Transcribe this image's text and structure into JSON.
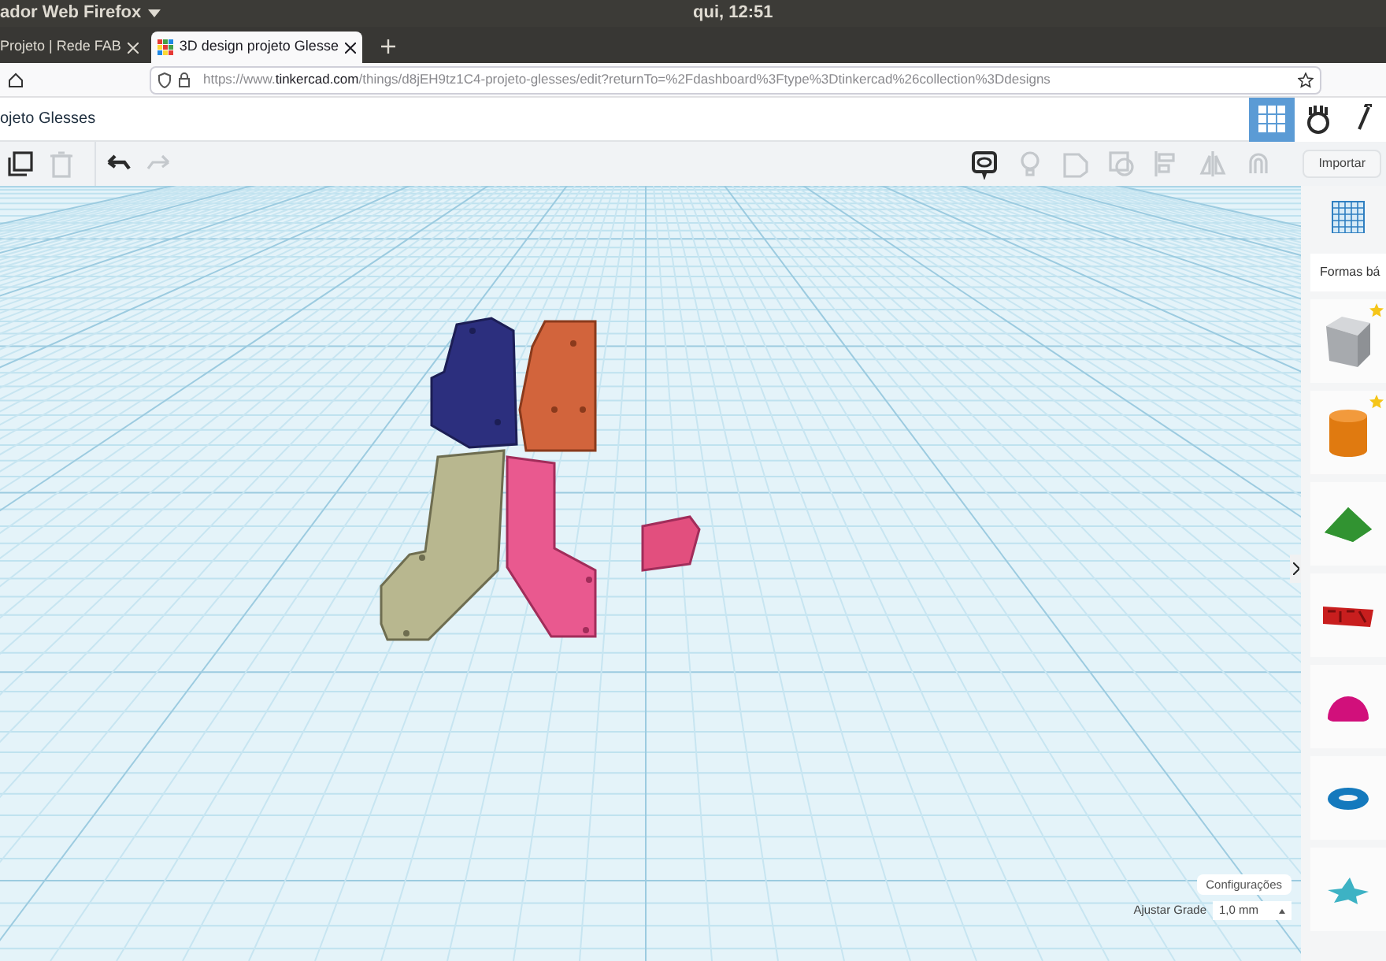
{
  "system_bar": {
    "app_menu": "ador Web Firefox",
    "clock": "qui, 12:51"
  },
  "browser": {
    "tabs": [
      {
        "label": "Projeto | Rede FAB",
        "selected": false
      },
      {
        "label": "3D design projeto Glesse",
        "selected": true
      }
    ],
    "url": {
      "prefix": "https://www.",
      "host": "tinkercad.com",
      "path": "/things/d8jEH9tz1C4-projeto-glesses/edit?returnTo=%2Fdashboard%3Ftype%3Dtinkercad%26collection%3Ddesigns"
    }
  },
  "header": {
    "title": "ojeto Glesses",
    "views": [
      {
        "kind": "grid",
        "selected": true
      },
      {
        "kind": "blocks",
        "selected": false
      },
      {
        "kind": "bricks",
        "selected": false
      }
    ]
  },
  "toolbar": {
    "left": [
      {
        "kind": "copy",
        "disabled": false
      },
      {
        "kind": "delete",
        "disabled": true
      },
      {
        "kind": "undo",
        "disabled": false
      },
      {
        "kind": "redo",
        "disabled": true
      }
    ],
    "right": [
      {
        "kind": "notes",
        "disabled": false
      },
      {
        "kind": "light",
        "disabled": true
      },
      {
        "kind": "solid",
        "disabled": true
      },
      {
        "kind": "hole",
        "disabled": true
      },
      {
        "kind": "align",
        "disabled": true
      },
      {
        "kind": "mirror",
        "disabled": true
      },
      {
        "kind": "magnet",
        "disabled": true
      }
    ],
    "import_button": "Importar"
  },
  "panel": {
    "category": "Formas bá",
    "shapes": [
      {
        "kind": "box",
        "starred": true
      },
      {
        "kind": "cylinder",
        "starred": true
      },
      {
        "kind": "roof",
        "starred": false
      },
      {
        "kind": "text",
        "starred": false
      },
      {
        "kind": "half-sphere",
        "starred": false
      },
      {
        "kind": "torus",
        "starred": false
      },
      {
        "kind": "star",
        "starred": false
      }
    ]
  },
  "workplane": {
    "settings_button": "Configurações",
    "snap_label": "Ajustar Grade",
    "snap_value": "1,0 mm"
  }
}
